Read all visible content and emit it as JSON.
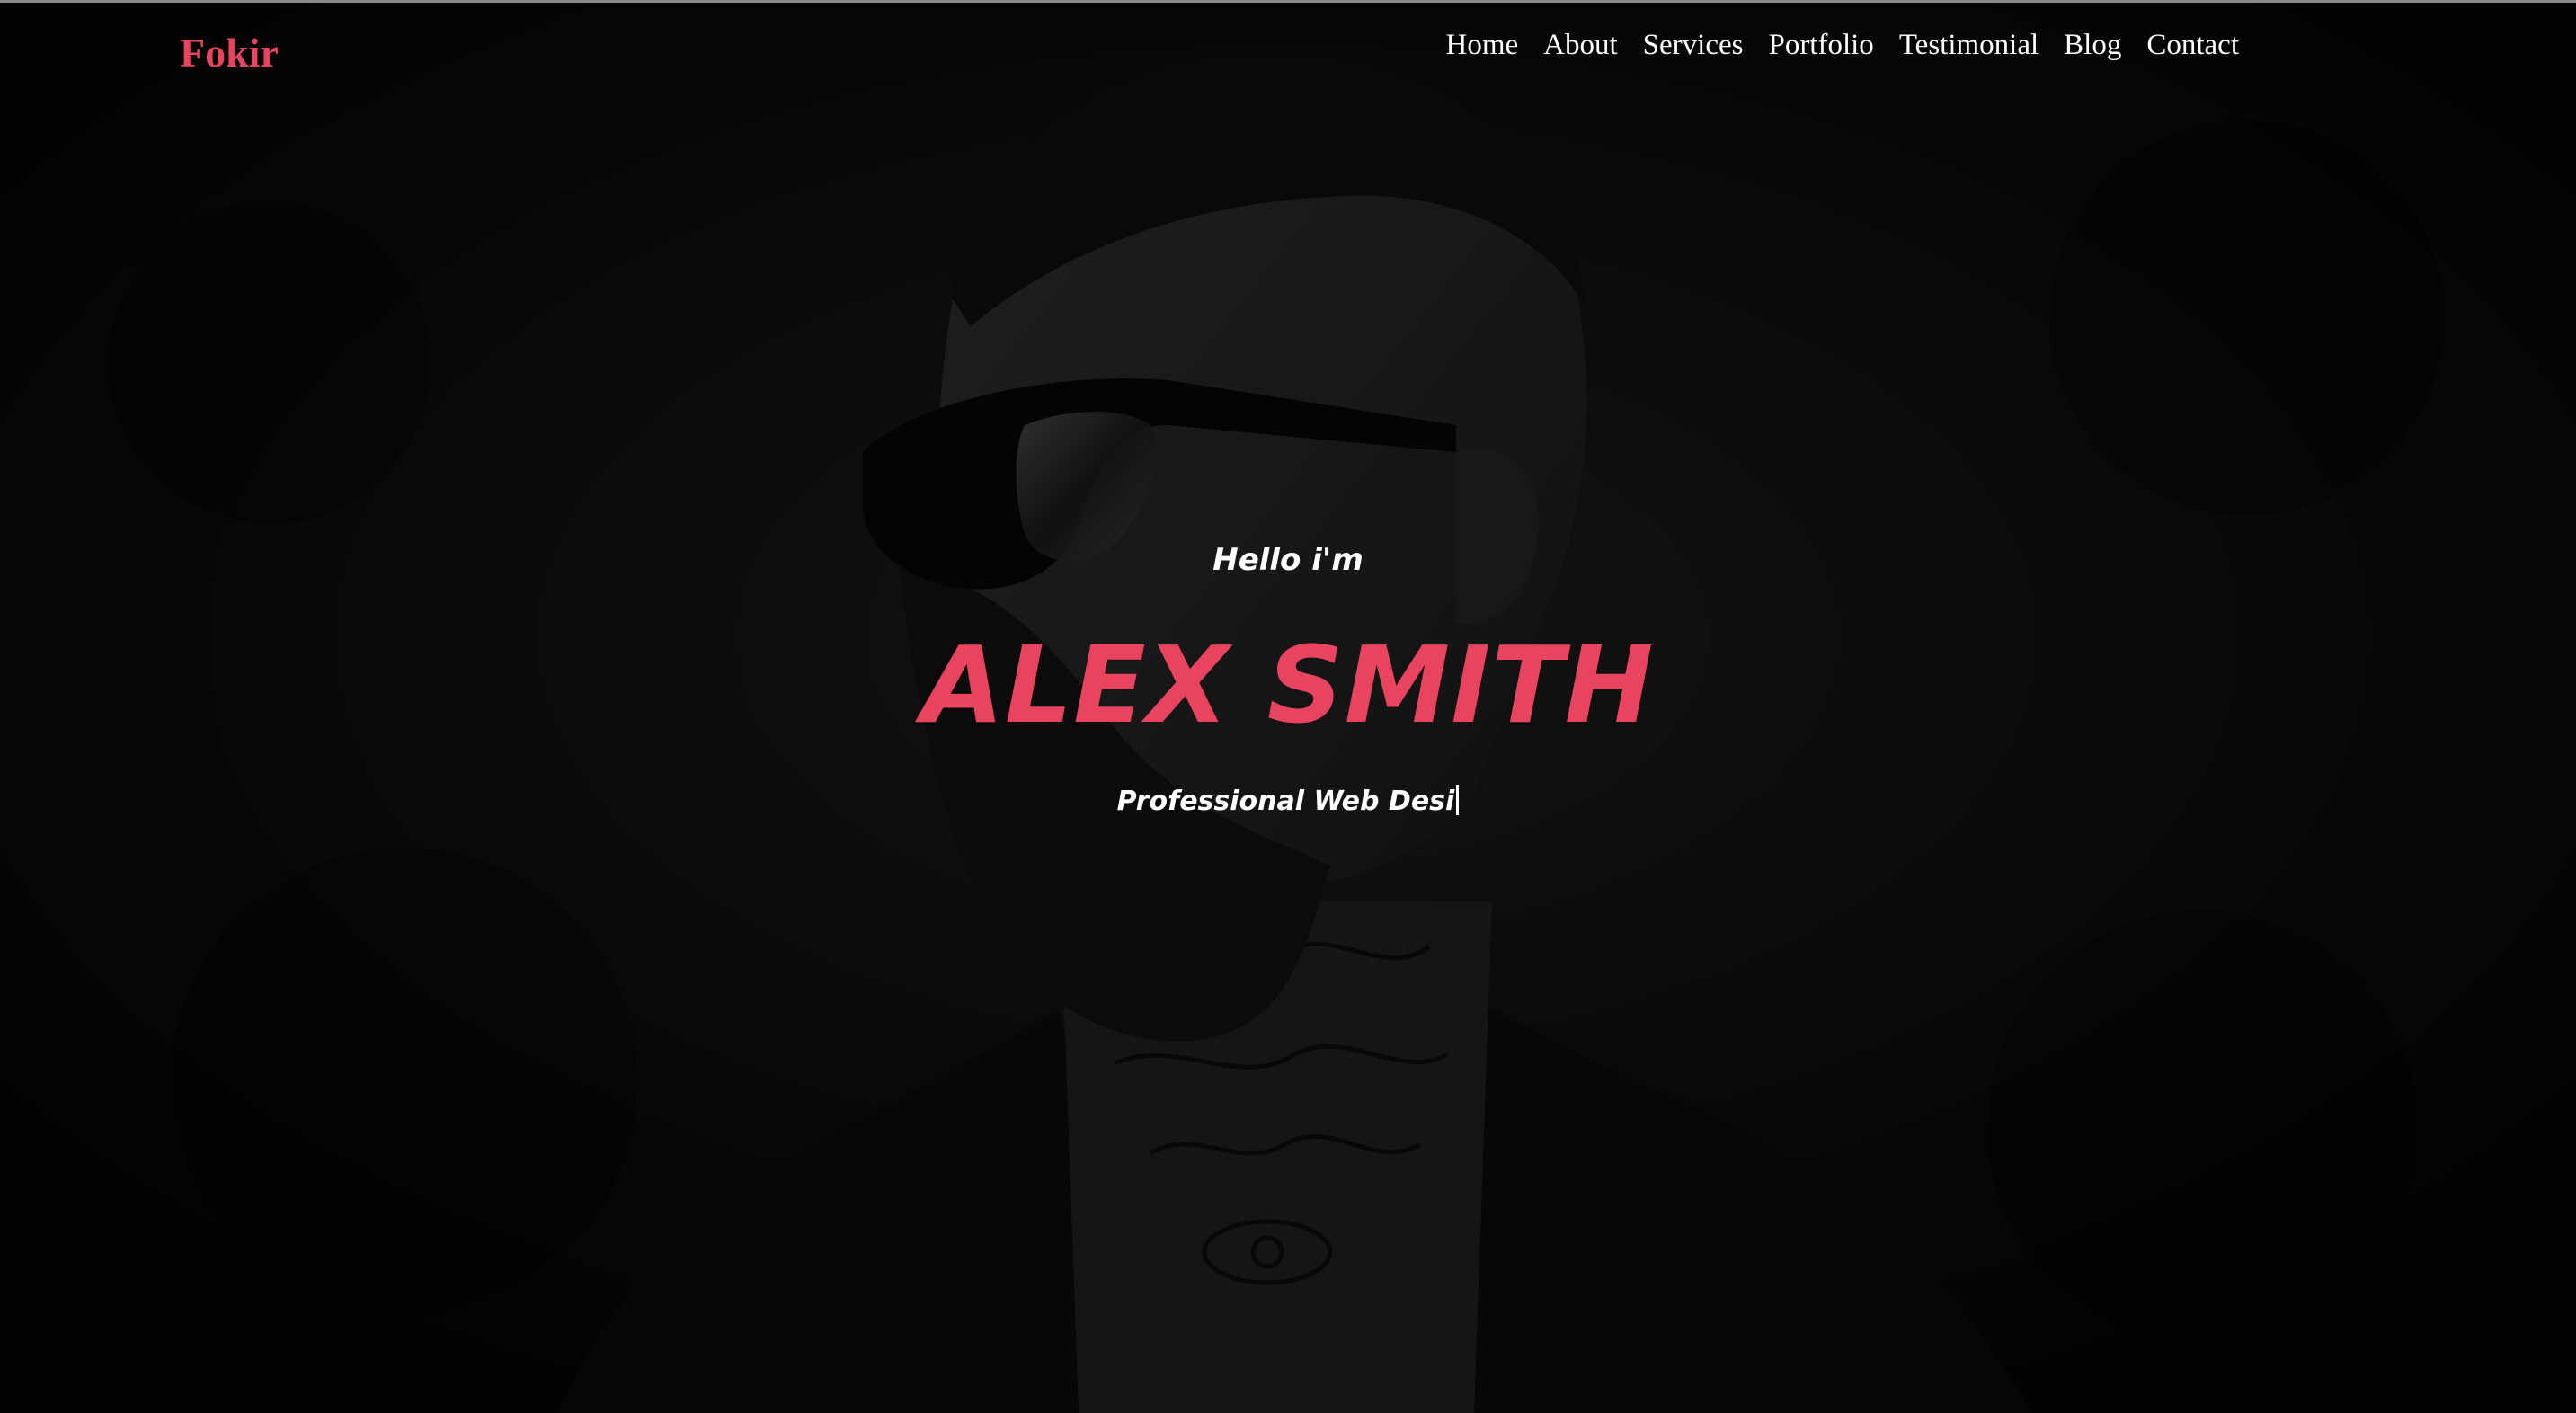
{
  "brand": {
    "logo_text": "Fokir",
    "accent_color": "#e8435f"
  },
  "nav": {
    "items": [
      {
        "label": "Home"
      },
      {
        "label": "About"
      },
      {
        "label": "Services"
      },
      {
        "label": "Portfolio"
      },
      {
        "label": "Testimonial"
      },
      {
        "label": "Blog"
      },
      {
        "label": "Contact"
      }
    ]
  },
  "hero": {
    "greeting": "Hello i'm",
    "name": "ALEX SMITH",
    "role_typed": "Professional Web Desi",
    "background_image": "bearded-man-with-sunglasses-and-neck-tattoos"
  }
}
